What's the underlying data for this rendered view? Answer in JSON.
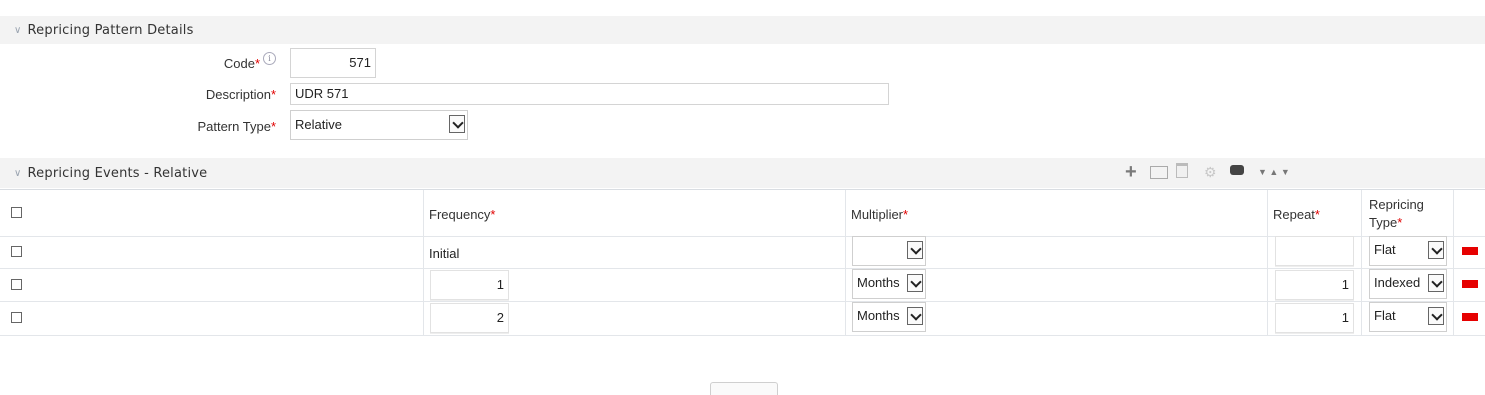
{
  "details": {
    "title": "Repricing Pattern Details",
    "code_label": "Code",
    "code_value": "571",
    "description_label": "Description",
    "description_value": "UDR 571",
    "pattern_type_label": "Pattern Type",
    "pattern_type_value": "Relative",
    "required_mark": "*"
  },
  "events": {
    "title": "Repricing Events - Relative",
    "columns": {
      "frequency": "Frequency",
      "multiplier": "Multiplier",
      "repeat": "Repeat",
      "repricing_type_line1": "Repricing",
      "repricing_type_line2": "Type"
    },
    "rows": [
      {
        "frequency": "Initial",
        "multiplier": "",
        "repeat": "",
        "repricing_type": "Flat"
      },
      {
        "frequency": "1",
        "multiplier": "Months",
        "repeat": "1",
        "repricing_type": "Indexed"
      },
      {
        "frequency": "2",
        "multiplier": "Months",
        "repeat": "1",
        "repricing_type": "Flat"
      }
    ]
  },
  "toolbar_icons": [
    "add-icon",
    "detail-icon",
    "delete-icon",
    "settings-icon",
    "tag-icon",
    "sort-icon"
  ],
  "colors": {
    "required": "#e00000",
    "row_flag": "#e60000",
    "section_bg": "#f3f3f3"
  }
}
